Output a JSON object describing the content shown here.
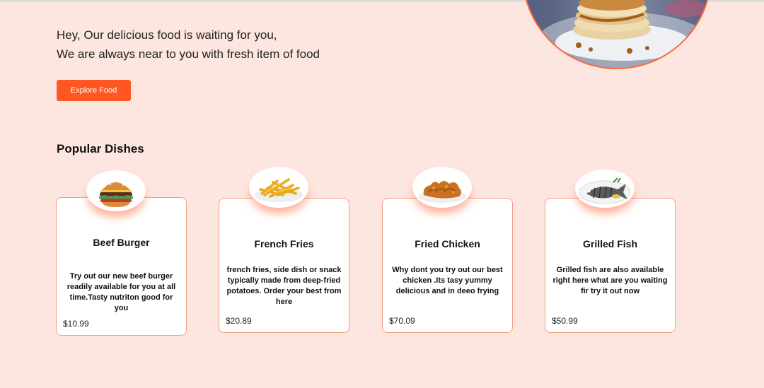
{
  "hero": {
    "line1": "Hey, Our delicious food is waiting for you,",
    "line2": "We are always near to you with fresh item of food",
    "button_label": "Explore Food",
    "image_icon": "pancakes-plate-image"
  },
  "popular": {
    "title": "Popular Dishes",
    "dishes": [
      {
        "name": "Beef Burger",
        "description": "Try out our new beef burger readily available for you at all time.Tasty nutriton good for you",
        "price": "$10.99",
        "image_icon": "burger-image"
      },
      {
        "name": "French Fries",
        "description": "french fries, side dish or snack typically made from deep-fried potatoes. Order your best from here",
        "price": "$20.89",
        "image_icon": "fries-image"
      },
      {
        "name": "Fried Chicken",
        "description": "Why dont you try out our best chicken .Its tasy yummy delicious and in deeo frying",
        "price": "$70.09",
        "image_icon": "fried-chicken-image"
      },
      {
        "name": "Grilled Fish",
        "description": "Grilled fish are also available right here what are you waiting fir try it out now",
        "price": "$50.99",
        "image_icon": "grilled-fish-image"
      }
    ]
  },
  "colors": {
    "background": "#fde6df",
    "accent": "#ff5722",
    "card_border": "#f2a085"
  }
}
